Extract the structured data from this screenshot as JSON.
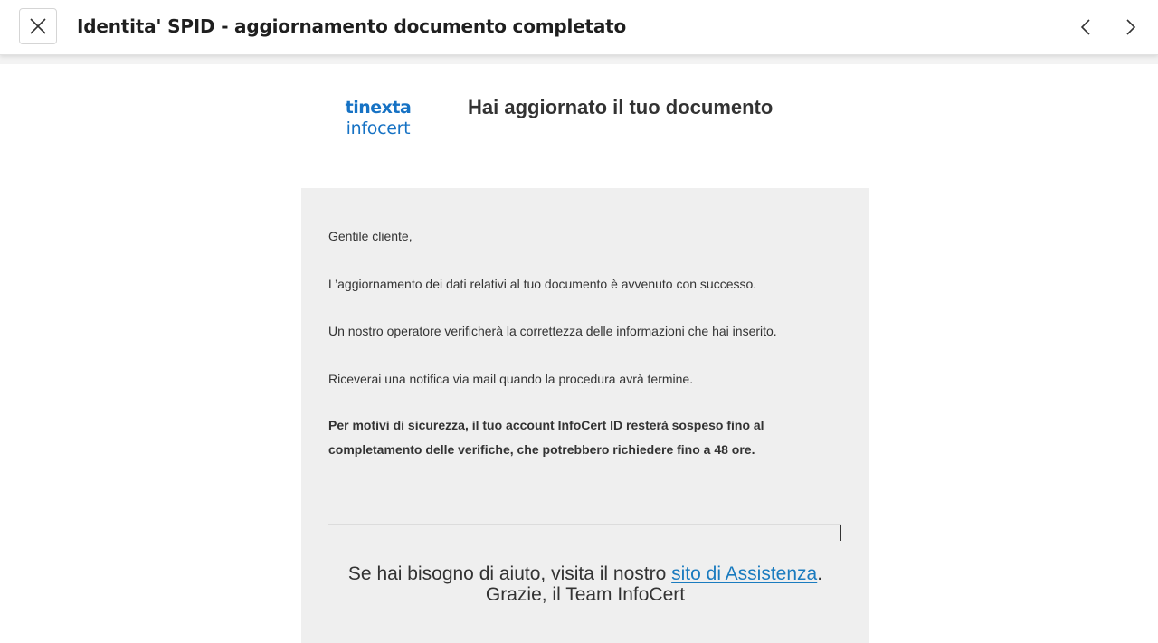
{
  "header": {
    "subject": "Identita' SPID - aggiornamento documento completato",
    "close_icon": "close-icon",
    "prev_icon": "chevron-left-icon",
    "next_icon": "chevron-right-icon"
  },
  "email": {
    "logo": {
      "line1": "tinexta",
      "line2": "infocert",
      "color": "#1672c4"
    },
    "heading": "Hai aggiornato il tuo documento",
    "paragraphs": [
      "Gentile cliente,",
      "L’aggiornamento dei dati relativi al tuo documento è avvenuto con successo.",
      "Un nostro operatore verificherà la correttezza delle informazioni che hai inserito.",
      "Riceverai una notifica via mail quando la procedura avrà termine."
    ],
    "security_note": "Per motivi di sicurezza, il tuo account InfoCert ID resterà sospeso fino al completamento delle verifiche, che potrebbero richiedere fino a 48 ore.",
    "footer": {
      "help_prefix": "Se hai bisogno di aiuto, visita il nostro ",
      "help_link": "sito di Assistenza",
      "help_suffix": ".",
      "thanks": "Grazie, il Team InfoCert"
    },
    "card_color": "#efefef",
    "link_color": "#1a7bbf"
  }
}
